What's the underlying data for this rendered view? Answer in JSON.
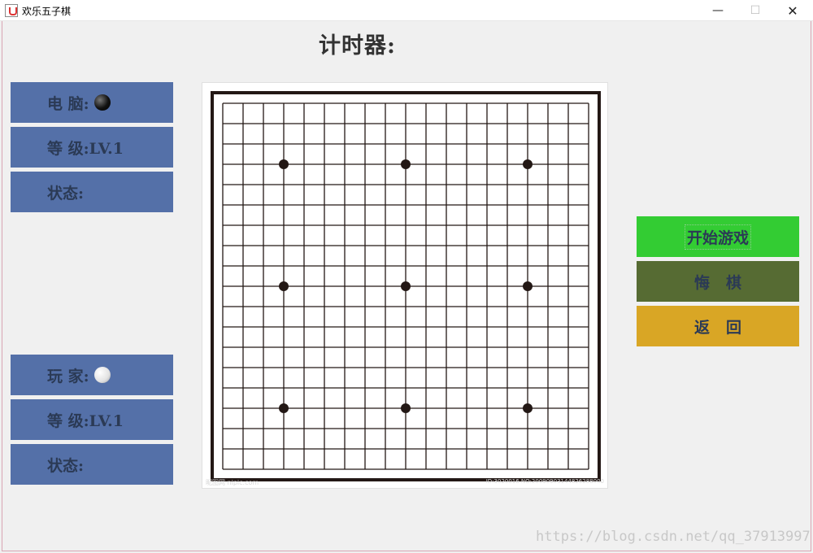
{
  "window": {
    "title": "欢乐五子棋",
    "controls": {
      "minimize": "—",
      "maximize": "☐",
      "close": "✕"
    }
  },
  "timer": {
    "label": "计时器:"
  },
  "computer": {
    "name_label": "电  脑:",
    "stone_icon": "black-stone-icon",
    "level_label": "等  级:LV.1",
    "status_label": "状态:"
  },
  "player": {
    "name_label": "玩  家:",
    "stone_icon": "white-stone-icon",
    "level_label": "等  级:LV.1",
    "status_label": "状态:"
  },
  "actions": {
    "start": "开始游戏",
    "undo": "悔棋",
    "back": "返回"
  },
  "board": {
    "lines": 19,
    "star_points": [
      [
        3,
        3
      ],
      [
        3,
        9
      ],
      [
        3,
        15
      ],
      [
        9,
        3
      ],
      [
        9,
        9
      ],
      [
        9,
        15
      ],
      [
        15,
        3
      ],
      [
        15,
        9
      ],
      [
        15,
        15
      ]
    ],
    "line_color": "#231815",
    "watermark_left": "昵图网 nipic.com",
    "watermark_right": "ID:3020016 NO:20090903144826288000"
  },
  "footer": {
    "watermark": "https://blog.csdn.net/qq_37913997"
  },
  "colors": {
    "panel_blue": "#5470a8",
    "start_green": "#33cc33",
    "undo_olive": "#566b33",
    "back_gold": "#d9a625"
  }
}
